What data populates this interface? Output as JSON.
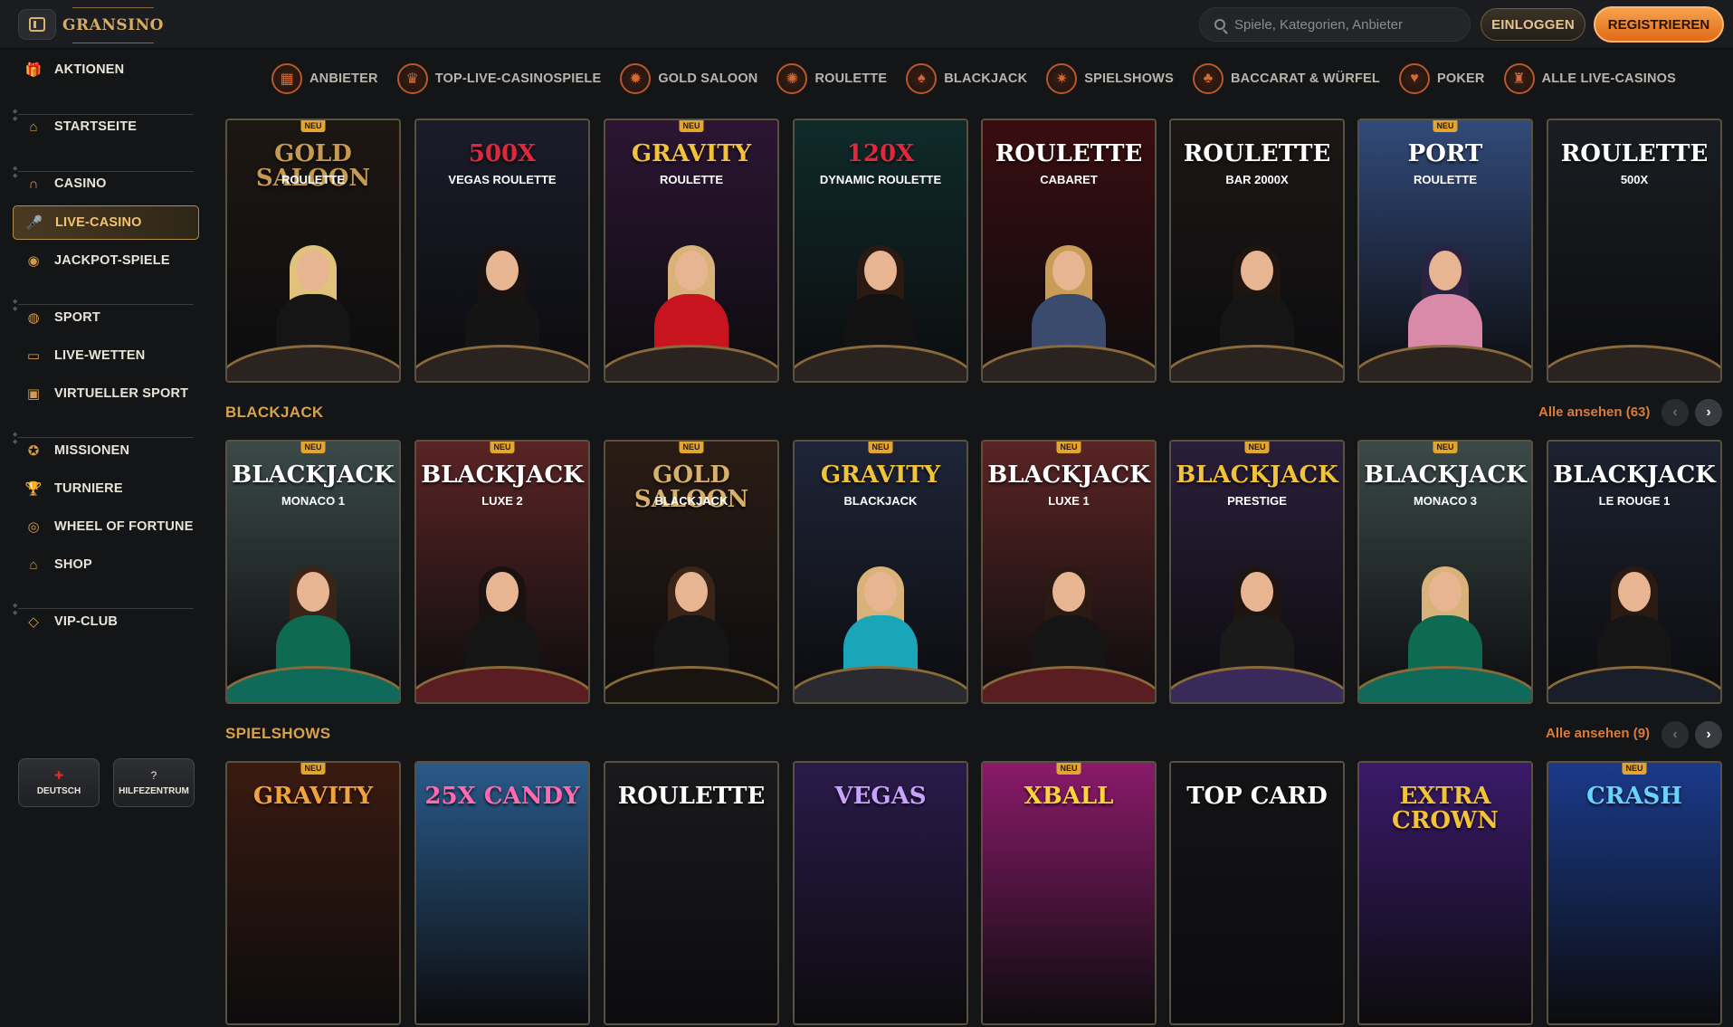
{
  "header": {
    "logo_text": "GRANSINO",
    "search_placeholder": "Spiele, Kategorien, Anbieter",
    "login_label": "EINLOGGEN",
    "register_label": "REGISTRIEREN"
  },
  "sidebar": {
    "items": [
      {
        "label": "AKTIONEN",
        "icon": "gift-icon",
        "glyph": "🎁"
      },
      {
        "label": "STARTSEITE",
        "icon": "home-icon",
        "glyph": "⌂"
      },
      {
        "label": "CASINO",
        "icon": "horseshoe-icon",
        "glyph": "∩"
      },
      {
        "label": "LIVE-CASINO",
        "icon": "microphone-icon",
        "glyph": "🎤"
      },
      {
        "label": "JACKPOT-SPIELE",
        "icon": "jackpot-icon",
        "glyph": "◉"
      },
      {
        "label": "SPORT",
        "icon": "basketball-icon",
        "glyph": "◍"
      },
      {
        "label": "LIVE-WETTEN",
        "icon": "live-icon",
        "glyph": "▭"
      },
      {
        "label": "VIRTUELLER SPORT",
        "icon": "virtual-sport-icon",
        "glyph": "▣"
      },
      {
        "label": "MISSIONEN",
        "icon": "medal-icon",
        "glyph": "✪"
      },
      {
        "label": "TURNIERE",
        "icon": "trophy-icon",
        "glyph": "🏆"
      },
      {
        "label": "WHEEL OF FORTUNE",
        "icon": "wheel-icon",
        "glyph": "◎"
      },
      {
        "label": "SHOP",
        "icon": "shop-icon",
        "glyph": "⌂"
      },
      {
        "label": "VIP-CLUB",
        "icon": "diamond-icon",
        "glyph": "◇"
      }
    ],
    "footer": {
      "language_label": "DEUTSCH",
      "help_label": "HILFEZENTRUM"
    }
  },
  "categories": [
    {
      "label": "ANBIETER",
      "icon": "provider-icon",
      "glyph": "▦"
    },
    {
      "label": "TOP-LIVE-CASINOSPIELE",
      "icon": "top-games-icon",
      "glyph": "♛"
    },
    {
      "label": "GOLD SALOON",
      "icon": "gold-saloon-icon",
      "glyph": "✹"
    },
    {
      "label": "ROULETTE",
      "icon": "roulette-icon",
      "glyph": "✺"
    },
    {
      "label": "BLACKJACK",
      "icon": "blackjack-icon",
      "glyph": "♠"
    },
    {
      "label": "SPIELSHOWS",
      "icon": "gameshow-icon",
      "glyph": "✷"
    },
    {
      "label": "BACCARAT & WÜRFEL",
      "icon": "baccarat-icon",
      "glyph": "♣"
    },
    {
      "label": "POKER",
      "icon": "poker-icon",
      "glyph": "♥"
    },
    {
      "label": "ALLE LIVE-CASINOS",
      "icon": "all-live-icon",
      "glyph": "♜"
    }
  ],
  "sections": {
    "blackjack": {
      "title": "BLACKJACK",
      "see_all": "Alle ansehen (63)"
    },
    "spielshows": {
      "title": "SPIELSHOWS",
      "see_all": "Alle ansehen (9)"
    }
  },
  "new_badge": "NEU",
  "rows": {
    "roulette": [
      {
        "title": "Gold Saloon",
        "sub": "ROULETTE",
        "new": true,
        "bg": "#1d1712",
        "accent": "#c79a52",
        "hair": "#e0c27c",
        "body": "#151515"
      },
      {
        "title": "500x",
        "sub": "VEGAS ROULETTE",
        "new": false,
        "bg": "#1a1c2a",
        "accent": "#e0283c",
        "hair": "#1a1210",
        "body": "#141414"
      },
      {
        "title": "Gravity",
        "sub": "ROULETTE",
        "new": true,
        "bg": "#2c1533",
        "accent": "#f2c23a",
        "hair": "#d9b27a",
        "body": "#c8141e"
      },
      {
        "title": "120x",
        "sub": "DYNAMIC ROULETTE",
        "new": false,
        "bg": "#0f2a2a",
        "accent": "#e0283c",
        "hair": "#2a1a12",
        "body": "#121212"
      },
      {
        "title": "ROULETTE",
        "sub": "CABARET",
        "new": false,
        "bg": "#3a0d10",
        "accent": "#ffffff",
        "hair": "#c99c58",
        "body": "#3a4b6e"
      },
      {
        "title": "ROULETTE",
        "sub": "BAR 2000X",
        "new": false,
        "bg": "#1c1715",
        "accent": "#ffffff",
        "hair": "#1e1510",
        "body": "#151515"
      },
      {
        "title": "PORT",
        "sub": "ROULETTE",
        "new": true,
        "bg": "#324a7a",
        "accent": "#ffffff",
        "hair": "#2a2240",
        "body": "#d98aa8"
      },
      {
        "title": "ROULETTE",
        "sub": "500X",
        "new": false,
        "bg": "#1a1e22",
        "accent": "#ffffff",
        "hair": "",
        "body": ""
      }
    ],
    "blackjack": [
      {
        "title": "BLACKJACK",
        "sub": "MONACO 1",
        "new": true,
        "bg": "#3b4a48",
        "accent": "#ffffff",
        "hair": "#3a2418",
        "body": "#0f6a52",
        "table": "#0f6a5a"
      },
      {
        "title": "BLACKJACK",
        "sub": "LUXE 2",
        "new": true,
        "bg": "#5a2424",
        "accent": "#ffffff",
        "hair": "#1a1210",
        "body": "#151515",
        "table": "#5a1e22"
      },
      {
        "title": "Gold Saloon",
        "sub": "BLACKJACK",
        "new": true,
        "bg": "#2a1c15",
        "accent": "#d8b06a",
        "hair": "#3a2418",
        "body": "#151515",
        "table": "#1a1410"
      },
      {
        "title": "Gravity",
        "sub": "BLACKJACK",
        "new": true,
        "bg": "#1e2538",
        "accent": "#f2c23a",
        "hair": "#d9b27a",
        "body": "#1aa6b8",
        "table": "#2a2a30"
      },
      {
        "title": "BLACKJACK",
        "sub": "LUXE 1",
        "new": true,
        "bg": "#5a2424",
        "accent": "#ffffff",
        "hair": "#2a1a12",
        "body": "#151515",
        "table": "#5a1e22"
      },
      {
        "title": "BLACKJACK",
        "sub": "PRESTIGE",
        "new": true,
        "bg": "#2a1e3a",
        "accent": "#f2c23a",
        "hair": "#1e1510",
        "body": "#1a1a1a",
        "table": "#3a2a5a"
      },
      {
        "title": "BLACKJACK",
        "sub": "MONACO 3",
        "new": true,
        "bg": "#3b4a48",
        "accent": "#ffffff",
        "hair": "#d9b27a",
        "body": "#0f6a52",
        "table": "#0f6a5a"
      },
      {
        "title": "BLACKJACK",
        "sub": "LE ROUGE 1",
        "new": false,
        "bg": "#1c2230",
        "accent": "#ffffff",
        "hair": "#2a1a12",
        "body": "#151515",
        "table": "#1a1e28"
      }
    ],
    "spielshows": [
      {
        "title": "GRAVITY",
        "sub": "",
        "new": true,
        "bg": "#3a1a10",
        "accent": "#f2a23a"
      },
      {
        "title": "25x Candy",
        "sub": "",
        "new": false,
        "bg": "#2a5a8a",
        "accent": "#ff6ab0"
      },
      {
        "title": "ROULETTE",
        "sub": "",
        "new": false,
        "bg": "#1a1a1c",
        "accent": "#ffffff"
      },
      {
        "title": "VEGAS",
        "sub": "",
        "new": false,
        "bg": "#2a1a4a",
        "accent": "#c8a2ff"
      },
      {
        "title": "Xball",
        "sub": "",
        "new": true,
        "bg": "#8a1a6a",
        "accent": "#ffd23a"
      },
      {
        "title": "TOP CARD",
        "sub": "",
        "new": false,
        "bg": "#141416",
        "accent": "#ffffff"
      },
      {
        "title": "Extra Crown",
        "sub": "",
        "new": false,
        "bg": "#3a1a6a",
        "accent": "#f2c23a"
      },
      {
        "title": "CRASH",
        "sub": "",
        "new": true,
        "bg": "#1a3a8a",
        "accent": "#6ad2ff"
      }
    ]
  }
}
